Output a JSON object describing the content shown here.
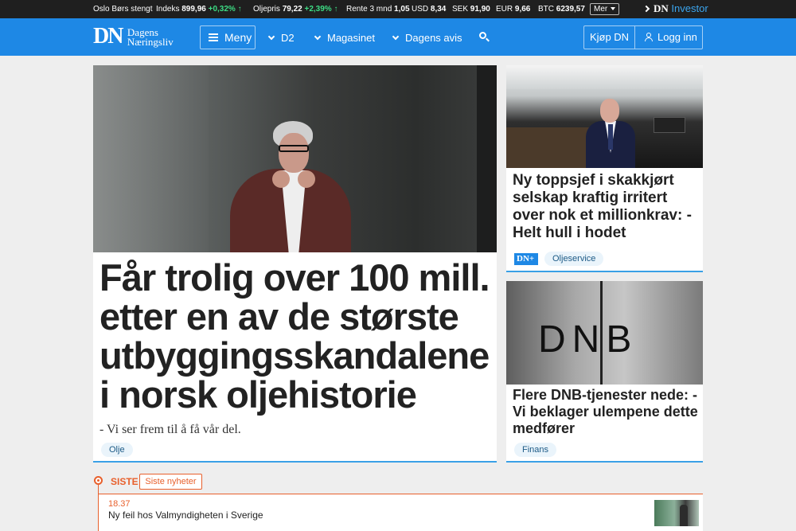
{
  "ticker": {
    "oslo": "Oslo Børs stengt",
    "indeks_label": "Indeks",
    "indeks_value": "899,96",
    "indeks_change": "+0,32%",
    "olje_label": "Oljepris",
    "olje_value": "79,22",
    "olje_change": "+2,39%",
    "rente_label": "Rente 3 mnd",
    "rente_value": "1,05",
    "usd_label": "USD",
    "usd_value": "8,34",
    "sek_label": "SEK",
    "sek_value": "91,90",
    "eur_label": "EUR",
    "eur_value": "9,66",
    "btc_label": "BTC",
    "btc_value": "6239,57",
    "more_select": "Mer",
    "investor_dn": "DN",
    "investor_label": "Investor"
  },
  "nav": {
    "logo_dn": "DN",
    "logo_line1": "Dagens",
    "logo_line2": "Næringsliv",
    "menu": "Meny",
    "d2": "D2",
    "magasinet": "Magasinet",
    "dagens_avis": "Dagens avis",
    "buy": "Kjøp DN",
    "login": "Logg inn"
  },
  "main_article": {
    "headline": "Får trolig over 100 mill. etter en av de største utbyggingsskandalene i norsk oljehistorie",
    "lead": "- Vi ser frem til å få vår del.",
    "tag": "Olje"
  },
  "side_article_1": {
    "headline": "Ny toppsjef i skakkjørt selskap kraftig irritert over nok et millionkrav: - Helt hull i hodet",
    "badge": "DN+",
    "tag": "Oljeservice"
  },
  "side_article_2": {
    "image_text": "DNB",
    "headline": "Flere DNB-tjenester nede: - Vi beklager ulempene dette medfører",
    "tag": "Finans"
  },
  "latest": {
    "label": "SISTE",
    "button": "Siste nyheter",
    "items": [
      {
        "time": "18.37",
        "text": "Ny feil hos Valmyndigheten i Sverige"
      }
    ]
  },
  "colors": {
    "nav_blue": "#1e88e5",
    "ticker_bg": "#1f1f1f",
    "positive": "#3ddc84",
    "accent_orange": "#e8602c",
    "card_border": "#3aa0e6"
  }
}
